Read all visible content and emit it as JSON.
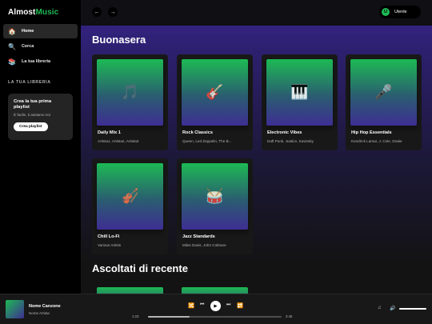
{
  "app": {
    "logo_main": "Almost",
    "logo_accent": "Music",
    "accent_color": "#1db954"
  },
  "sidebar": {
    "items": [
      {
        "label": "Home",
        "icon": "home-icon",
        "active": true
      },
      {
        "label": "Cerca",
        "icon": "search-icon",
        "active": false
      },
      {
        "label": "La tua libreria",
        "icon": "library-icon",
        "active": false
      }
    ],
    "library_heading": "LA TUA LIBRERIA",
    "create_card": {
      "title": "Crea la tua prima playlist",
      "subtitle": "È facile, ti aiutiamo noi",
      "button": "Crea playlist"
    }
  },
  "topbar": {
    "back": "←",
    "forward": "→",
    "user_initial": "U",
    "user_name": "Utente"
  },
  "main": {
    "greeting": "Buonasera",
    "playlists": [
      {
        "title": "Daily Mix 1",
        "subtitle": "Artista1, Artista2, Artista3",
        "icon": "music-note-icon"
      },
      {
        "title": "Rock Classics",
        "subtitle": "Queen, Led Zeppelin, The B...",
        "icon": "guitar-icon"
      },
      {
        "title": "Electronic Vibes",
        "subtitle": "Daft Punk, Justice, Kavinsky",
        "icon": "piano-icon"
      },
      {
        "title": "Hip Hop Essentials",
        "subtitle": "Kendrick Lamar, J. Cole, Drake",
        "icon": "microphone-icon"
      },
      {
        "title": "Chill Lo-Fi",
        "subtitle": "Various Artists",
        "icon": "violin-icon"
      },
      {
        "title": "Jazz Standards",
        "subtitle": "Miles Davis, John Coltrane",
        "icon": "drum-icon"
      }
    ],
    "recent_title": "Ascoltati di recente"
  },
  "player": {
    "track_title": "Nome Canzone",
    "track_artist": "Nome Artista",
    "time_current": "1:23",
    "time_total": "3:45",
    "progress": 0.31,
    "volume": 1.0
  }
}
